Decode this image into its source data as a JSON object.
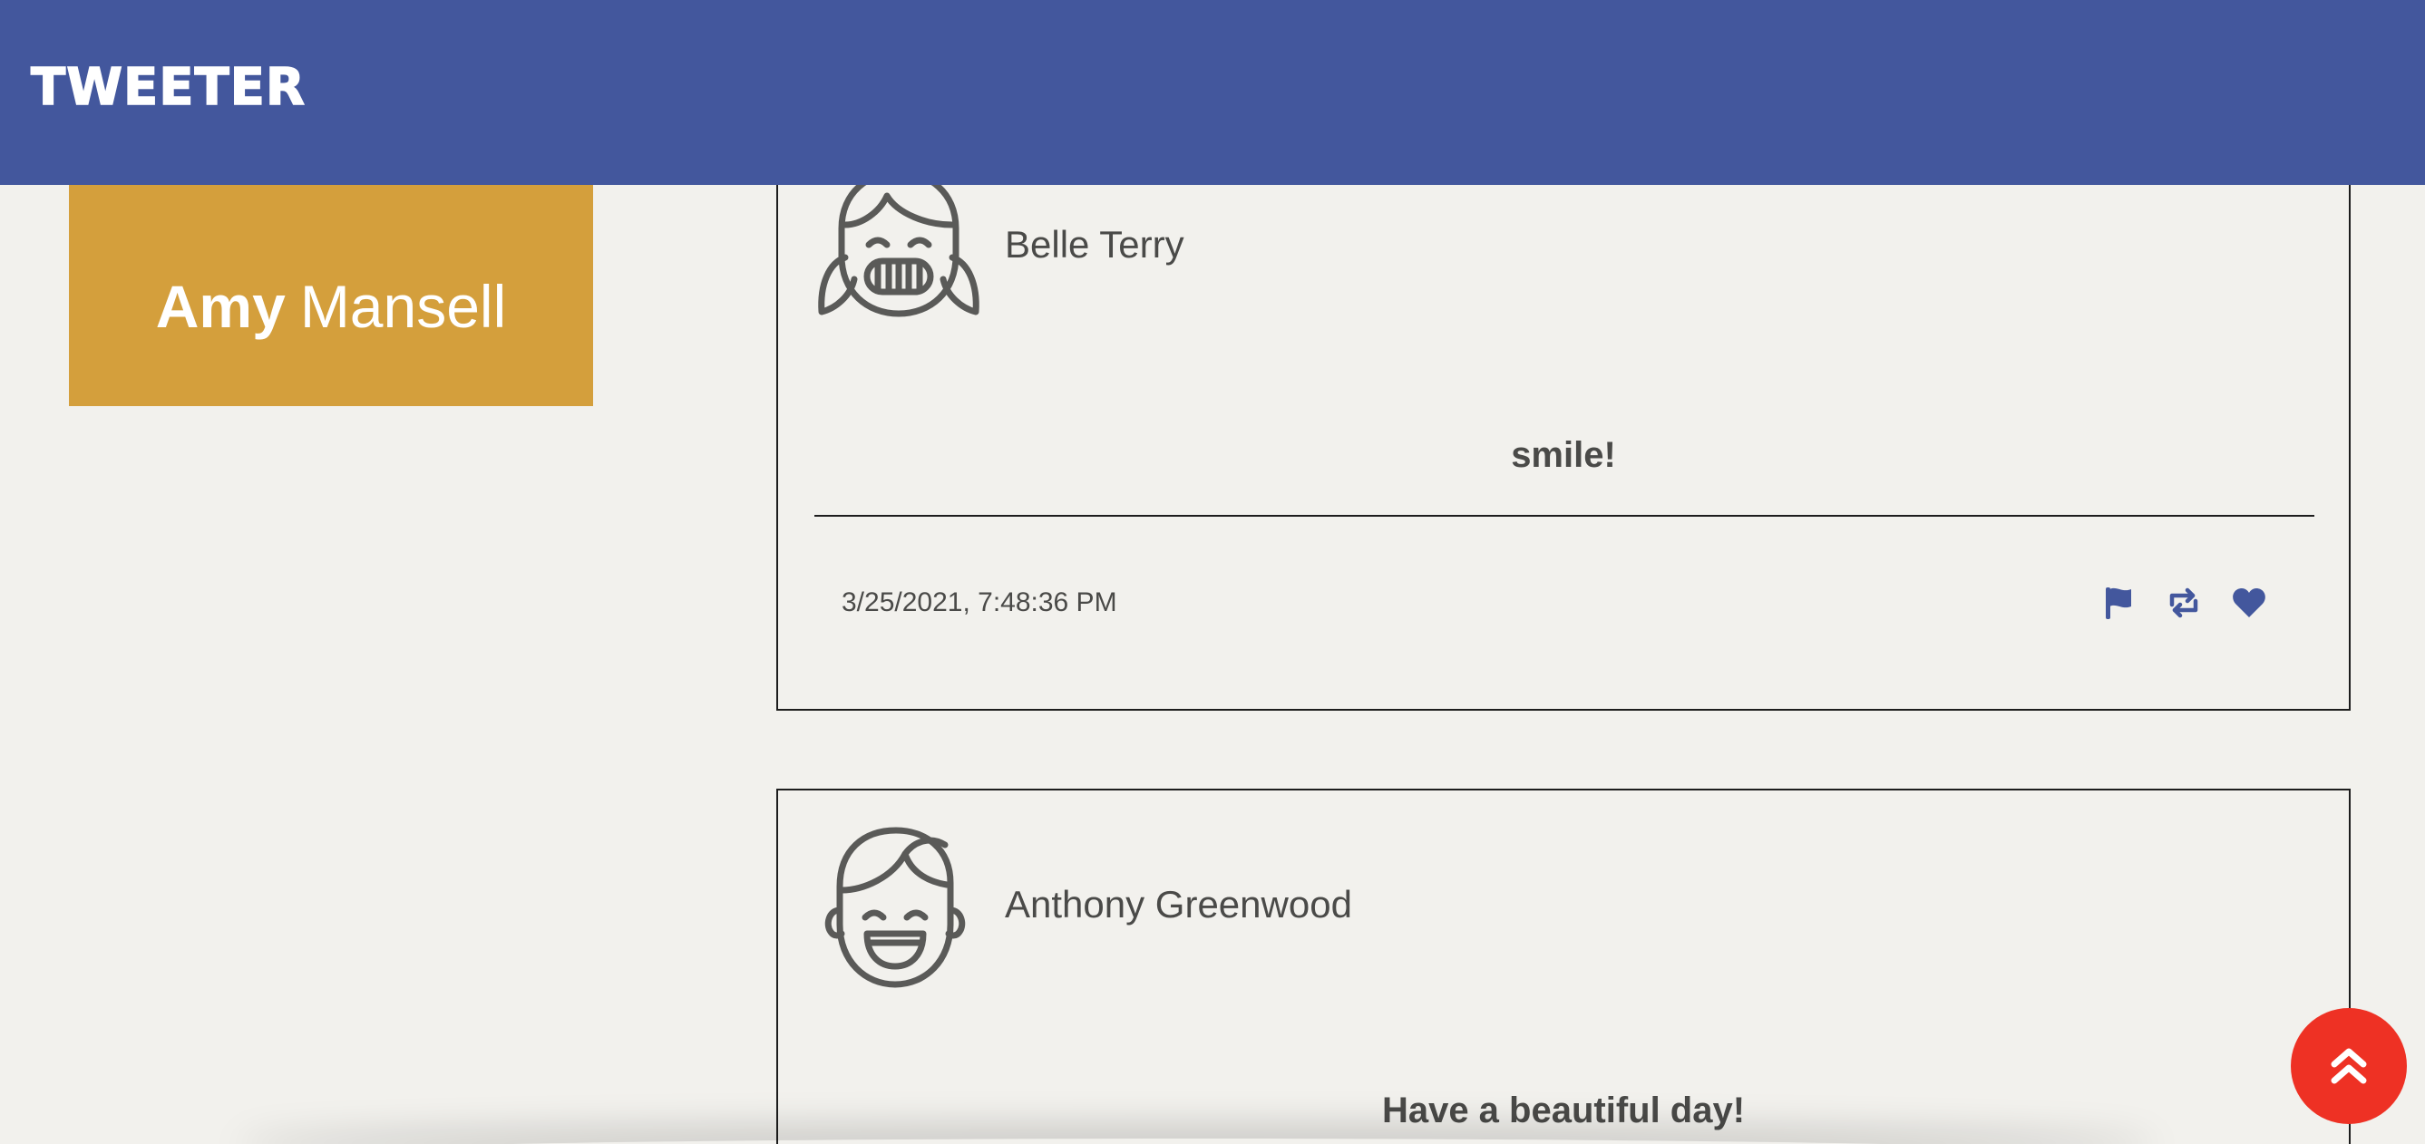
{
  "header": {
    "brand": "TWEETER"
  },
  "profile": {
    "first_name": "Amy",
    "last_name": "Mansell"
  },
  "tweets": [
    {
      "author": "Belle Terry",
      "avatar_icon": "girl-pigtails-face-icon",
      "text": "smile!",
      "timestamp": "3/25/2021, 7:48:36 PM",
      "actions": [
        "flag-icon",
        "retweet-icon",
        "heart-icon"
      ]
    },
    {
      "author": "Anthony Greenwood",
      "avatar_icon": "boy-face-icon",
      "text": "Have a beautiful day!"
    }
  ],
  "colors": {
    "header_bg": "#43579d",
    "profile_bg": "#d49f3c",
    "page_bg": "#f2f1ed",
    "accent_icon": "#43579d",
    "fab_bg": "#ee3124"
  },
  "fab": {
    "icon": "double-chevron-up-icon"
  }
}
